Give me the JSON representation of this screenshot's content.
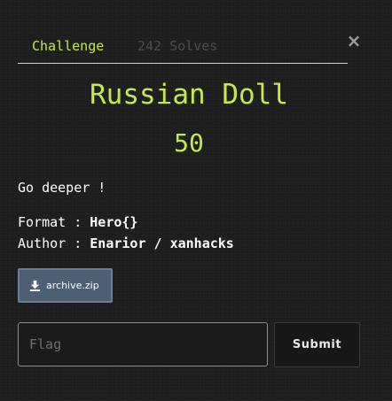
{
  "tabs": {
    "challenge_label": "Challenge",
    "solves_label": "242 Solves"
  },
  "close_label": "×",
  "challenge": {
    "name": "Russian Doll",
    "value": "50",
    "description": "Go deeper !",
    "format_label": "Format : ",
    "format_value": "Hero{}",
    "author_label": "Author : ",
    "author_value": "Enarior / xanhacks"
  },
  "file": {
    "name": "archive.zip",
    "icon": "download-icon"
  },
  "flag_form": {
    "placeholder": "Flag",
    "value": "",
    "submit_label": "Submit"
  },
  "colors": {
    "accent": "#c4e94a",
    "background": "#1e1e1e",
    "file_button": "#4e5f73"
  }
}
